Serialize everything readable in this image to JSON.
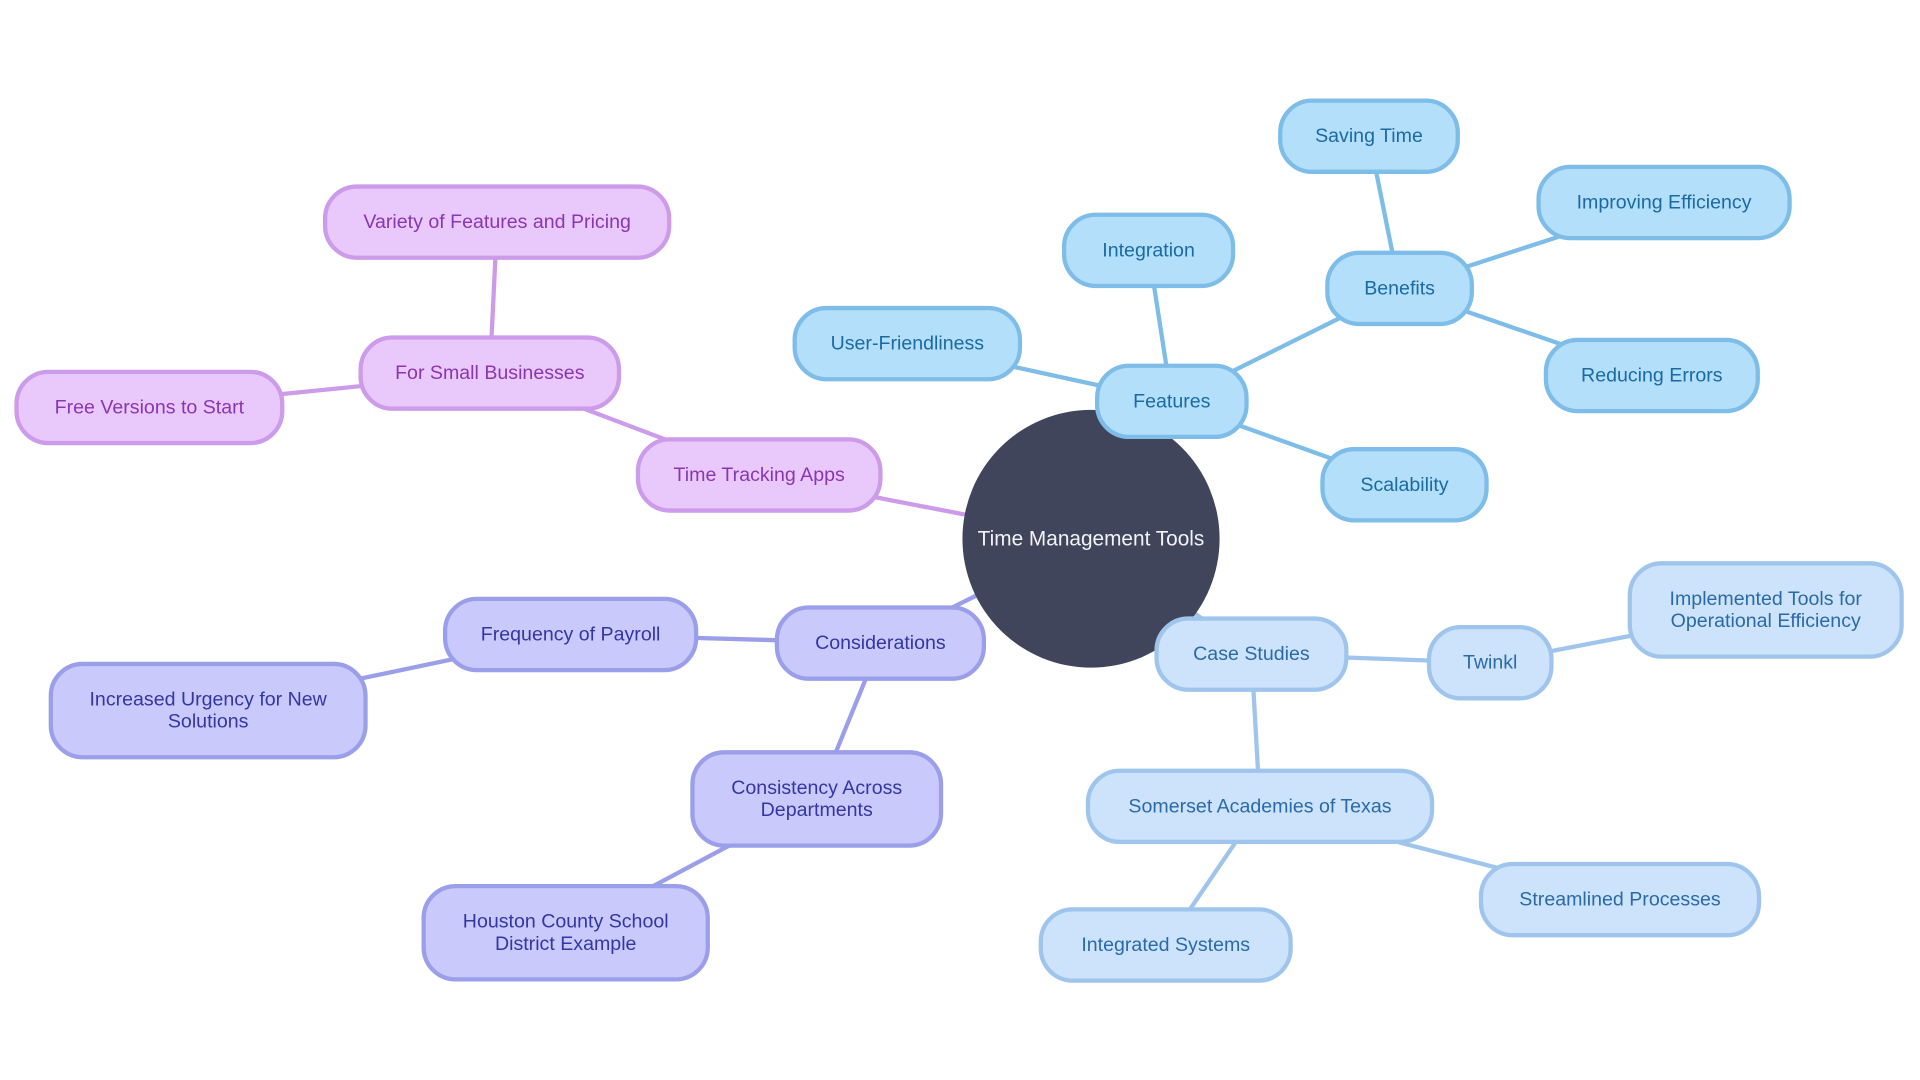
{
  "diagram": {
    "type": "mindmap",
    "root": {
      "id": "root",
      "label": "Time Management Tools",
      "color": "#41455b"
    },
    "palette": {
      "features": {
        "fill": "#b3dffb",
        "stroke": "#7dbde8",
        "text": "#1a6aa3"
      },
      "case": {
        "fill": "#cde3fb",
        "stroke": "#9fc5ec",
        "text": "#2a6aa8"
      },
      "apps": {
        "fill": "#e9c9fb",
        "stroke": "#cc9be9",
        "text": "#8a36b2"
      },
      "considerations": {
        "fill": "#c9cafb",
        "stroke": "#9b9ee9",
        "text": "#3336a3"
      }
    },
    "nodes": [
      {
        "id": "features",
        "label": "Features",
        "branch": "features",
        "parent": "root"
      },
      {
        "id": "user-friendliness",
        "label": "User-Friendliness",
        "branch": "features",
        "parent": "features"
      },
      {
        "id": "integration",
        "label": "Integration",
        "branch": "features",
        "parent": "features"
      },
      {
        "id": "benefits",
        "label": "Benefits",
        "branch": "features",
        "parent": "features"
      },
      {
        "id": "saving-time",
        "label": "Saving Time",
        "branch": "features",
        "parent": "benefits"
      },
      {
        "id": "improving-efficiency",
        "label": "Improving Efficiency",
        "branch": "features",
        "parent": "benefits"
      },
      {
        "id": "reducing-errors",
        "label": "Reducing Errors",
        "branch": "features",
        "parent": "benefits"
      },
      {
        "id": "scalability",
        "label": "Scalability",
        "branch": "features",
        "parent": "features"
      },
      {
        "id": "case-studies",
        "label": "Case Studies",
        "branch": "case",
        "parent": "root"
      },
      {
        "id": "twinkl",
        "label": "Twinkl",
        "branch": "case",
        "parent": "case-studies"
      },
      {
        "id": "implemented-tools",
        "label": "Implemented Tools for\nOperational Efficiency",
        "branch": "case",
        "parent": "twinkl"
      },
      {
        "id": "somerset",
        "label": "Somerset Academies of Texas",
        "branch": "case",
        "parent": "case-studies"
      },
      {
        "id": "integrated-systems",
        "label": "Integrated Systems",
        "branch": "case",
        "parent": "somerset"
      },
      {
        "id": "streamlined-processes",
        "label": "Streamlined Processes",
        "branch": "case",
        "parent": "somerset"
      },
      {
        "id": "time-tracking-apps",
        "label": "Time Tracking Apps",
        "branch": "apps",
        "parent": "root"
      },
      {
        "id": "small-businesses",
        "label": "For Small Businesses",
        "branch": "apps",
        "parent": "time-tracking-apps"
      },
      {
        "id": "variety",
        "label": "Variety of Features and Pricing",
        "branch": "apps",
        "parent": "small-businesses"
      },
      {
        "id": "free-versions",
        "label": "Free Versions to Start",
        "branch": "apps",
        "parent": "small-businesses"
      },
      {
        "id": "considerations",
        "label": "Considerations",
        "branch": "considerations",
        "parent": "root"
      },
      {
        "id": "payroll",
        "label": "Frequency of Payroll",
        "branch": "considerations",
        "parent": "considerations"
      },
      {
        "id": "urgency",
        "label": "Increased Urgency for New\nSolutions",
        "branch": "considerations",
        "parent": "payroll"
      },
      {
        "id": "consistency",
        "label": "Consistency Across\nDepartments",
        "branch": "considerations",
        "parent": "considerations"
      },
      {
        "id": "houston",
        "label": "Houston County School\nDistrict Example",
        "branch": "considerations",
        "parent": "consistency"
      }
    ]
  }
}
